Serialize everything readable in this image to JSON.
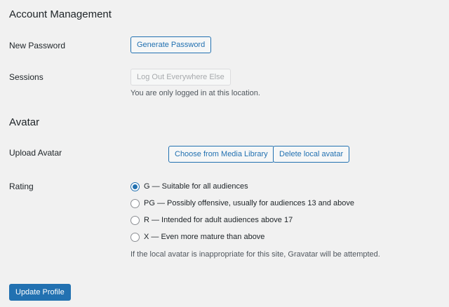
{
  "account": {
    "title": "Account Management",
    "new_password_label": "New Password",
    "generate_password_button": "Generate Password",
    "sessions_label": "Sessions",
    "logout_button": "Log Out Everywhere Else",
    "sessions_description": "You are only logged in at this location."
  },
  "avatar": {
    "title": "Avatar",
    "upload_label": "Upload Avatar",
    "choose_button": "Choose from Media Library",
    "delete_button": "Delete local avatar",
    "rating_label": "Rating",
    "rating_options": [
      {
        "label": "G — Suitable for all audiences",
        "checked": true
      },
      {
        "label": "PG — Possibly offensive, usually for audiences 13 and above",
        "checked": false
      },
      {
        "label": "R — Intended for adult audiences above 17",
        "checked": false
      },
      {
        "label": "X — Even more mature than above",
        "checked": false
      }
    ],
    "rating_description": "If the local avatar is inappropriate for this site, Gravatar will be attempted."
  },
  "footer": {
    "update_button": "Update Profile"
  },
  "colors": {
    "primary": "#2271b1",
    "background": "#f1f1f1"
  }
}
